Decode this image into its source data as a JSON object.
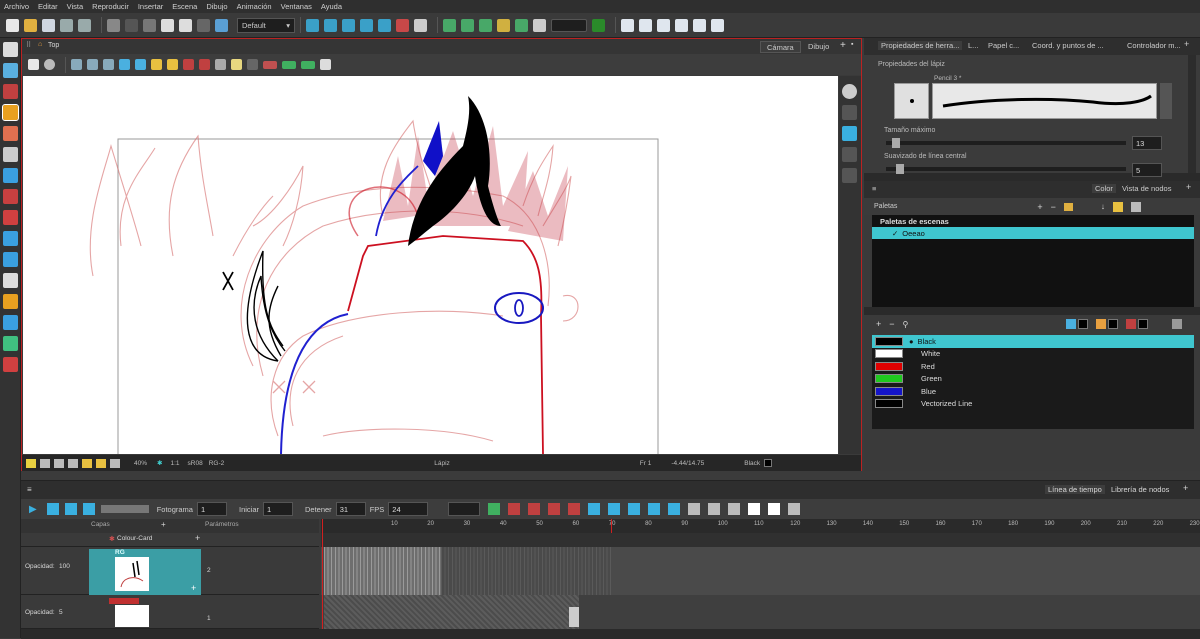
{
  "menu": [
    "Archivo",
    "Editar",
    "Vista",
    "Reproducir",
    "Insertar",
    "Escena",
    "Dibujo",
    "Animación",
    "Ventanas",
    "Ayuda"
  ],
  "toolbar": {
    "workspace": "Default"
  },
  "camera_view": {
    "breadcrumb": "Top",
    "tabs": [
      "Cámara",
      "Dibujo"
    ],
    "status": {
      "zoom": "40%",
      "rotation": "1:1",
      "drawing": "sR08",
      "layer": "RG-2",
      "tool": "Lápiz",
      "frame": "Fr 1",
      "coords": "-4.44/14.75",
      "color": "Black"
    }
  },
  "tool_properties": {
    "tabs": [
      "Propiedades de herra...",
      "L...",
      "Papel c...",
      "Coord. y puntos de ...",
      "Controlador m..."
    ],
    "section_title": "Propiedades del lápiz",
    "preset_name": "Pencil 3 *",
    "max_size_label": "Tamaño máximo",
    "max_size_value": "13",
    "smoothing_label": "Suavizado de línea central",
    "smoothing_value": "5"
  },
  "color_panel": {
    "tabs": [
      "Color",
      "Vista de nodos"
    ],
    "palettes_label": "Paletas",
    "scene_palettes_label": "Paletas de escenas",
    "palette_name": "Oeeao",
    "swatches": [
      {
        "name": "Black",
        "color": "#000000"
      },
      {
        "name": "White",
        "color": "#ffffff"
      },
      {
        "name": "Red",
        "color": "#e00000"
      },
      {
        "name": "Green",
        "color": "#1fc81f"
      },
      {
        "name": "Blue",
        "color": "#1414c8"
      },
      {
        "name": "Vectorized Line",
        "color": "#000000"
      }
    ],
    "highlight": "#3fc6cf"
  },
  "timeline": {
    "tabs": [
      "Línea de tiempo",
      "Librería de nodos"
    ],
    "frame_label": "Fotograma",
    "frame_value": "1",
    "start_label": "Iniciar",
    "start_value": "1",
    "stop_label": "Detener",
    "stop_value": "31",
    "fps_label": "FPS",
    "fps_value": "24",
    "layers_header": "Capas",
    "params_header": "Parámetros",
    "layers": [
      {
        "name": "Colour-Card",
        "opacity_label": "",
        "opacity": ""
      },
      {
        "name": "RG",
        "opacity_label": "Opacidad:",
        "opacity": "100",
        "number": "2"
      },
      {
        "name": "",
        "opacity_label": "Opacidad:",
        "opacity": "5",
        "number": "1"
      }
    ],
    "ruler_ticks": [
      "10",
      "20",
      "30",
      "40",
      "50",
      "60",
      "70",
      "80",
      "90",
      "100",
      "110",
      "120",
      "130",
      "140",
      "150",
      "160",
      "170",
      "180",
      "190",
      "200",
      "210",
      "220",
      "230"
    ]
  }
}
